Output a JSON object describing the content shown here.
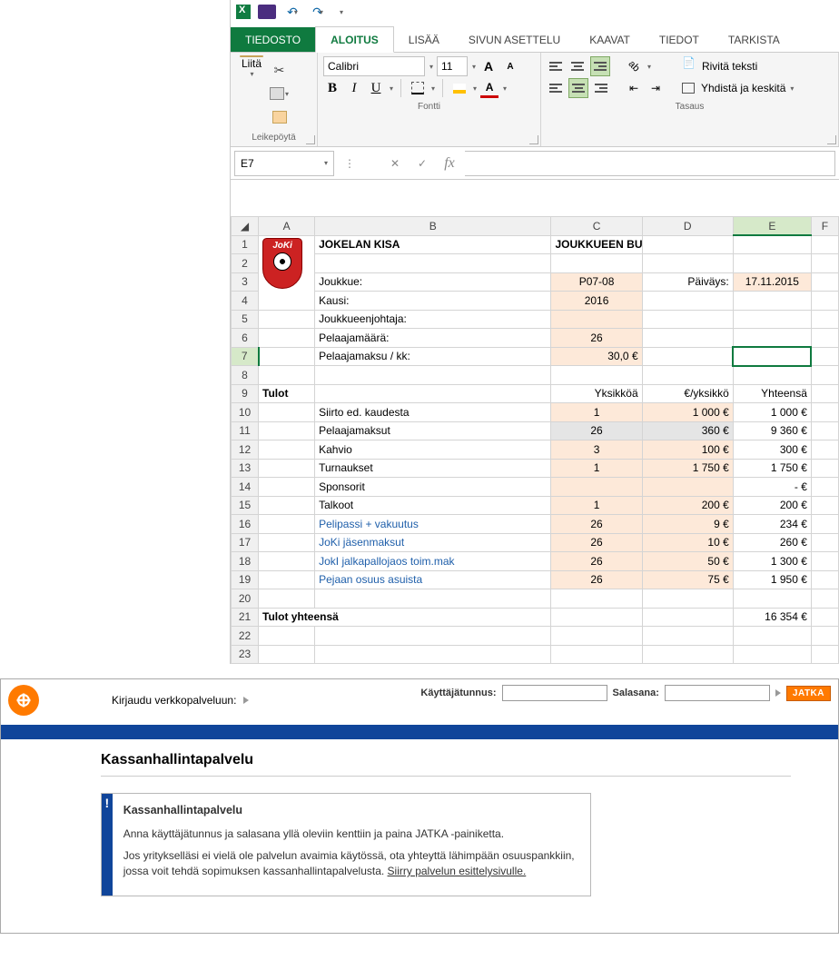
{
  "qat": {
    "undo": "↶",
    "redo": "↷"
  },
  "tabs": {
    "file": "TIEDOSTO",
    "home": "ALOITUS",
    "insert": "LISÄÄ",
    "layout": "SIVUN ASETTELU",
    "formulas": "KAAVAT",
    "data": "TIEDOT",
    "review": "TARKISTA"
  },
  "ribbon": {
    "paste": "Liitä",
    "clipboard_label": "Leikepöytä",
    "font_name": "Calibri",
    "font_size": "11",
    "font_label": "Fontti",
    "align_label": "Tasaus",
    "wrap_text": "Rivitä teksti",
    "merge": "Yhdistä ja keskitä"
  },
  "fbar": {
    "cell_ref": "E7",
    "fx": "fx"
  },
  "sheet": {
    "cols": [
      "A",
      "B",
      "C",
      "D",
      "E",
      "F"
    ],
    "title_b": "JOKELAN KISA",
    "title_c": "JOUKKUEEN BUDJETTI",
    "logo_text": "JoKi",
    "r3": {
      "b": "Joukkue:",
      "c": "P07-08",
      "d": "Päiväys:",
      "e": "17.11.2015"
    },
    "r4": {
      "b": "Kausi:",
      "c": "2016"
    },
    "r5": {
      "b": "Joukkueenjohtaja:"
    },
    "r6": {
      "b": "Pelaajamäärä:",
      "c": "26"
    },
    "r7": {
      "b": "Pelaajamaksu / kk:",
      "c": "30,0 €"
    },
    "r9": {
      "a": "Tulot",
      "c": "Yksikköä",
      "d": "€/yksikkö",
      "e": "Yhteensä"
    },
    "r10": {
      "b": "Siirto ed. kaudesta",
      "c": "1",
      "d": "1 000 €",
      "e": "1 000 €"
    },
    "r11": {
      "b": "Pelaajamaksut",
      "c": "26",
      "d": "360 €",
      "e": "9 360 €"
    },
    "r12": {
      "b": "Kahvio",
      "c": "3",
      "d": "100 €",
      "e": "300 €"
    },
    "r13": {
      "b": "Turnaukset",
      "c": "1",
      "d": "1 750 €",
      "e": "1 750 €"
    },
    "r14": {
      "b": "Sponsorit",
      "e": "-   €"
    },
    "r15": {
      "b": "Talkoot",
      "c": "1",
      "d": "200 €",
      "e": "200 €"
    },
    "r16": {
      "b": "Pelipassi + vakuutus",
      "c": "26",
      "d": "9 €",
      "e": "234 €"
    },
    "r17": {
      "b": "JoKi jäsenmaksut",
      "c": "26",
      "d": "10 €",
      "e": "260 €"
    },
    "r18": {
      "b": "JokI jalkapallojaos toim.mak",
      "c": "26",
      "d": "50 €",
      "e": "1 300 €"
    },
    "r19": {
      "b": "Pejaan osuus asuista",
      "c": "26",
      "d": "75 €",
      "e": "1 950 €"
    },
    "r21": {
      "a": "Tulot yhteensä",
      "e": "16 354 €"
    }
  },
  "bank": {
    "login_label": "Kirjaudu verkkopalveluun:",
    "user_label": "Käyttäjätunnus:",
    "pass_label": "Salasana:",
    "jatka": "JATKA",
    "page_title": "Kassanhallintapalvelu",
    "notice_mark": "!",
    "notice_title": "Kassanhallintapalvelu",
    "notice_p1": "Anna käyttäjätunnus ja salasana yllä oleviin kenttiin ja paina JATKA -painiketta.",
    "notice_p2_a": "Jos yritykselläsi ei vielä ole palvelun avaimia käytössä, ota yhteyttä lähimpään osuuspankkiin, jossa voit tehdä sopimuksen kassanhallintapalvelusta. ",
    "notice_link": "Siirry palvelun esittelysivulle."
  }
}
